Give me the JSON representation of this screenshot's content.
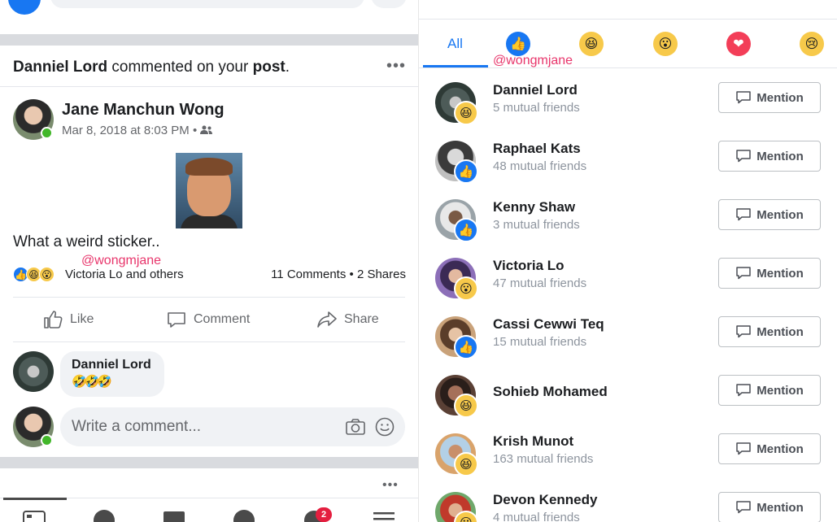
{
  "left": {
    "notification": {
      "actor": "Danniel Lord",
      "verb": "commented on your",
      "object": "post",
      "end": "."
    },
    "post": {
      "author": "Jane Manchun Wong",
      "timestamp": "Mar 8, 2018 at 8:03 PM",
      "separator": "•",
      "text": "What a weird sticker..",
      "watermark": "@wongmjane",
      "reacted_by": "Victoria Lo and others",
      "comments": "11 Comments",
      "shares": "2 Shares",
      "dot": "•"
    },
    "actions": {
      "like": "Like",
      "comment": "Comment",
      "share": "Share"
    },
    "comment": {
      "author": "Danniel Lord",
      "emojis": "🤣🤣🤣"
    },
    "composer": {
      "placeholder": "Write a comment..."
    },
    "menu_dots": "•••",
    "notifications_badge": "2"
  },
  "right": {
    "tabs": [
      {
        "label": "All",
        "active": true
      },
      {
        "icon": "like-icon"
      },
      {
        "icon": "haha-icon"
      },
      {
        "icon": "wow-icon"
      },
      {
        "icon": "love-icon"
      },
      {
        "icon": "sad-icon"
      }
    ],
    "watermark": "@wongmjane",
    "mention_label": "Mention",
    "people": [
      {
        "name": "Danniel Lord",
        "mutual": "5 mutual friends",
        "reaction": "haha"
      },
      {
        "name": "Raphael Kats",
        "mutual": "48 mutual friends",
        "reaction": "like"
      },
      {
        "name": "Kenny Shaw",
        "mutual": "3 mutual friends",
        "reaction": "like"
      },
      {
        "name": "Victoria Lo",
        "mutual": "47 mutual friends",
        "reaction": "wow"
      },
      {
        "name": "Cassi Cewwi Teq",
        "mutual": "15 mutual friends",
        "reaction": "like"
      },
      {
        "name": "Sohieb Mohamed",
        "mutual": "",
        "reaction": "haha"
      },
      {
        "name": "Krish Munot",
        "mutual": "163 mutual friends",
        "reaction": "haha"
      },
      {
        "name": "Devon Kennedy",
        "mutual": "4 mutual friends",
        "reaction": "wow"
      }
    ]
  },
  "colors": {
    "brand": "#1877f2",
    "love": "#f33e58",
    "emoji_yellow": "#f7c94a",
    "online": "#42b72a",
    "badge": "#e41e3f",
    "watermark": "#e8356b"
  }
}
